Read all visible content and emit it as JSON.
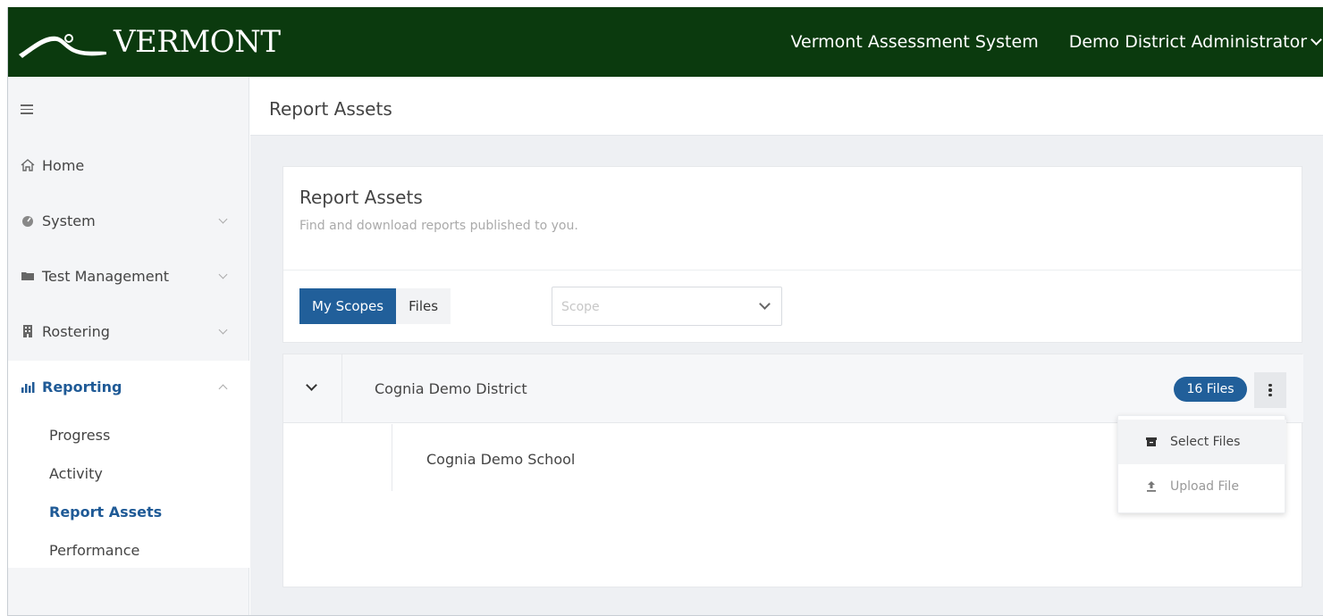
{
  "colors": {
    "topbar": "#003300",
    "accent": "#215f9a",
    "active_nav": "#1f5a96"
  },
  "header": {
    "logo_text": "VERMONT",
    "nav_system": "Vermont Assessment System",
    "nav_user": "Demo District Administrator"
  },
  "sidebar": {
    "menu_icon": "hamburger-icon",
    "items": [
      {
        "label": "Home",
        "icon": "home-icon"
      },
      {
        "label": "System",
        "icon": "gauge-icon"
      },
      {
        "label": "Test Management",
        "icon": "folder-icon"
      },
      {
        "label": "Rostering",
        "icon": "building-icon"
      },
      {
        "label": "Reporting",
        "icon": "bar-chart-icon"
      }
    ],
    "reporting_sub": [
      "Progress",
      "Activity",
      "Report Assets",
      "Performance"
    ]
  },
  "page": {
    "header_title": "Report Assets"
  },
  "card": {
    "title": "Report Assets",
    "subtitle": "Find and download reports published to you.",
    "tabs": [
      "My Scopes",
      "Files"
    ],
    "scope_placeholder": "Scope"
  },
  "tree": {
    "district": "Cognia Demo District",
    "files_badge": "16 Files",
    "school": "Cognia Demo School",
    "menu": [
      {
        "label": "Select Files",
        "icon": "archive-icon"
      },
      {
        "label": "Upload File",
        "icon": "upload-icon"
      }
    ]
  }
}
